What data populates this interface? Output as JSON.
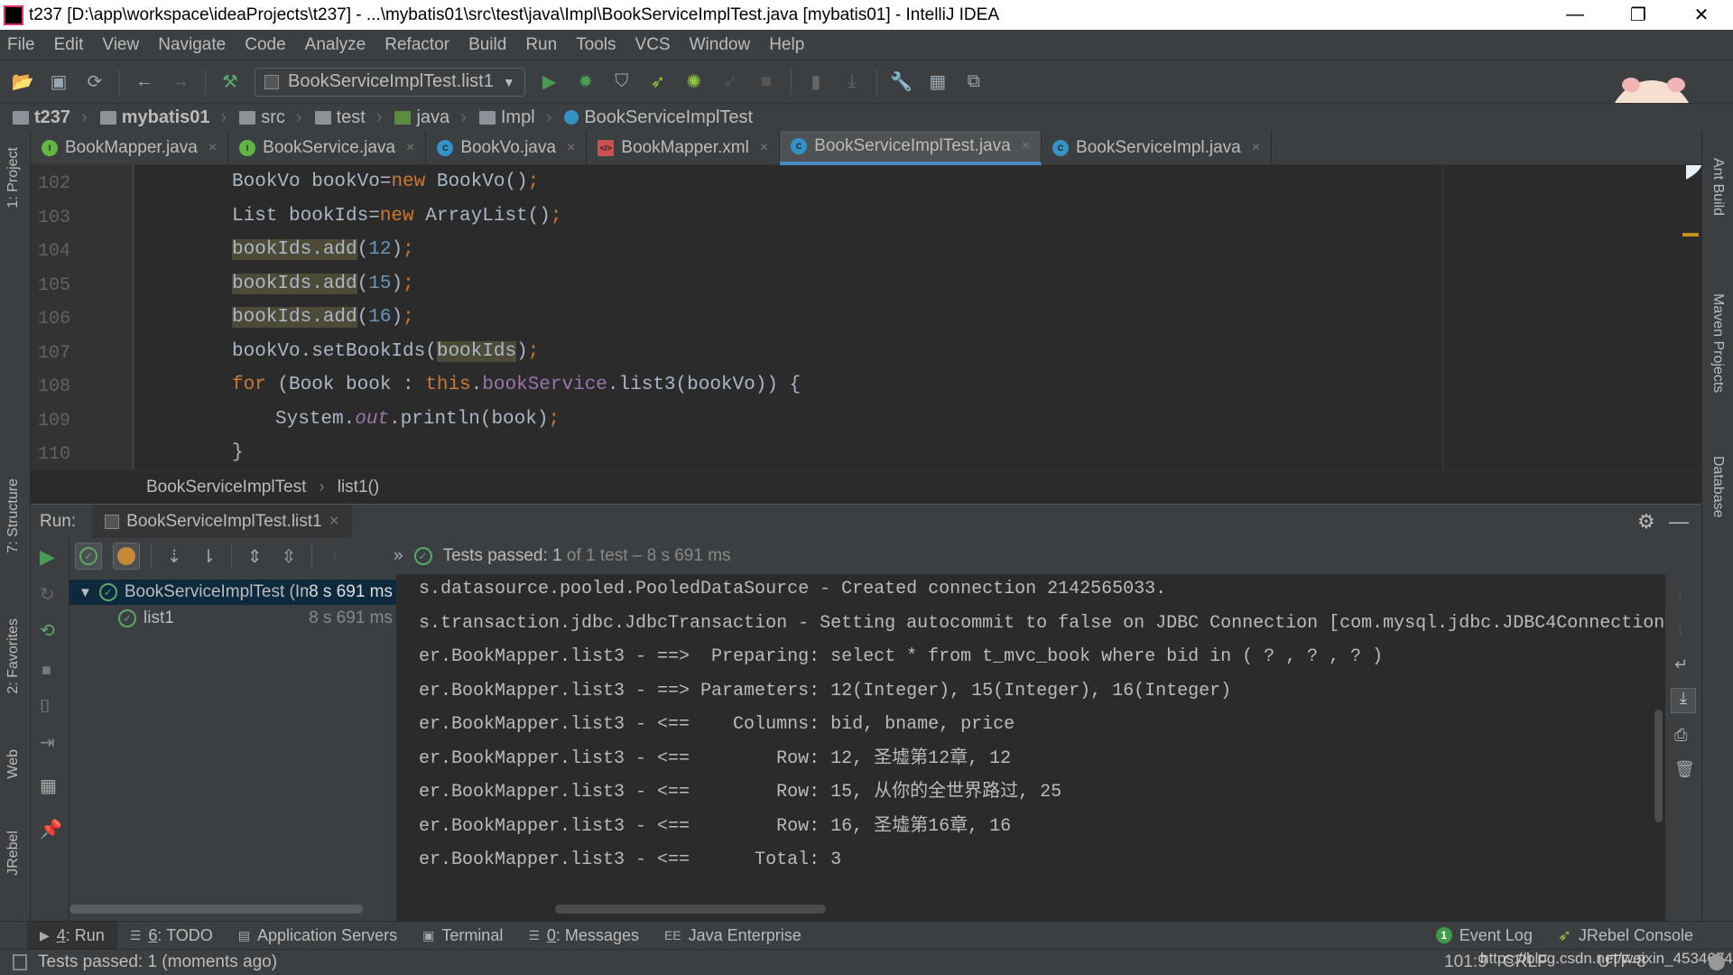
{
  "window": {
    "title": "t237 [D:\\app\\workspace\\ideaProjects\\t237] - ...\\mybatis01\\src\\test\\java\\Impl\\BookServiceImplTest.java [mybatis01] - IntelliJ IDEA",
    "minimize": "—",
    "maximize": "❐",
    "close": "✕"
  },
  "menu": [
    "File",
    "Edit",
    "View",
    "Navigate",
    "Code",
    "Analyze",
    "Refactor",
    "Build",
    "Run",
    "Tools",
    "VCS",
    "Window",
    "Help"
  ],
  "toolbar": {
    "run_config": "BookServiceImplTest.list1"
  },
  "breadcrumb": [
    "t237",
    "mybatis01",
    "src",
    "test",
    "java",
    "Impl",
    "BookServiceImplTest"
  ],
  "tabs": [
    {
      "label": "BookMapper.java",
      "icon": "I",
      "color": "#62b543",
      "active": false
    },
    {
      "label": "BookService.java",
      "icon": "I",
      "color": "#62b543",
      "active": false
    },
    {
      "label": "BookVo.java",
      "icon": "C",
      "color": "#3592c4",
      "active": false
    },
    {
      "label": "BookMapper.xml",
      "icon": "</>",
      "color": "#c75450",
      "active": false
    },
    {
      "label": "BookServiceImplTest.java",
      "icon": "C",
      "color": "#3592c4",
      "active": true
    },
    {
      "label": "BookServiceImpl.java",
      "icon": "C",
      "color": "#3592c4",
      "active": false
    }
  ],
  "editor": {
    "lines": [
      {
        "no": "102",
        "indent": 0,
        "tokens": [
          {
            "t": "BookVo bookVo=",
            "c": "p"
          },
          {
            "t": "new",
            "c": "k"
          },
          {
            "t": " BookVo()",
            "c": "p"
          },
          {
            "t": ";",
            "c": "s"
          }
        ]
      },
      {
        "no": "103",
        "indent": 0,
        "tokens": [
          {
            "t": "List bookIds=",
            "c": "p"
          },
          {
            "t": "new",
            "c": "k"
          },
          {
            "t": " ArrayList()",
            "c": "p"
          },
          {
            "t": ";",
            "c": "s"
          }
        ]
      },
      {
        "no": "104",
        "indent": 0,
        "tokens": [
          {
            "t": "bookIds.add",
            "c": "p hl"
          },
          {
            "t": "(",
            "c": "p"
          },
          {
            "t": "12",
            "c": "n"
          },
          {
            "t": ")",
            "c": "p"
          },
          {
            "t": ";",
            "c": "s"
          }
        ]
      },
      {
        "no": "105",
        "indent": 0,
        "tokens": [
          {
            "t": "bookIds.add",
            "c": "p hl"
          },
          {
            "t": "(",
            "c": "p"
          },
          {
            "t": "15",
            "c": "n"
          },
          {
            "t": ")",
            "c": "p"
          },
          {
            "t": ";",
            "c": "s"
          }
        ]
      },
      {
        "no": "106",
        "indent": 0,
        "tokens": [
          {
            "t": "bookIds.add",
            "c": "p hl"
          },
          {
            "t": "(",
            "c": "p"
          },
          {
            "t": "16",
            "c": "n"
          },
          {
            "t": ")",
            "c": "p"
          },
          {
            "t": ";",
            "c": "s"
          }
        ]
      },
      {
        "no": "107",
        "indent": 0,
        "tokens": [
          {
            "t": "bookVo.setBookIds(",
            "c": "p"
          },
          {
            "t": "bookIds",
            "c": "p hl"
          },
          {
            "t": ")",
            "c": "p"
          },
          {
            "t": ";",
            "c": "s"
          }
        ]
      },
      {
        "no": "108",
        "indent": 0,
        "tokens": [
          {
            "t": "for",
            "c": "k"
          },
          {
            "t": " (Book book : ",
            "c": "p"
          },
          {
            "t": "this",
            "c": "k"
          },
          {
            "t": ".",
            "c": "p"
          },
          {
            "t": "bookService",
            "c": "f"
          },
          {
            "t": ".list3(bookVo)) {",
            "c": "p"
          }
        ]
      },
      {
        "no": "109",
        "indent": 1,
        "tokens": [
          {
            "t": "System.",
            "c": "p"
          },
          {
            "t": "out",
            "c": "i"
          },
          {
            "t": ".println(book)",
            "c": "p"
          },
          {
            "t": ";",
            "c": "s"
          }
        ]
      },
      {
        "no": "110",
        "indent": 0,
        "tokens": [
          {
            "t": "}",
            "c": "p"
          }
        ]
      }
    ],
    "crumbs": [
      "BookServiceImplTest",
      "list1()"
    ]
  },
  "run": {
    "label": "Run:",
    "tab": "BookServiceImplTest.list1",
    "status_prefix": "Tests passed: ",
    "status_count": "1",
    "status_suffix": " of 1 test – 8 s 691 ms",
    "tree": [
      {
        "label": "BookServiceImplTest (Im",
        "time": "8 s 691 ms",
        "level": 0
      },
      {
        "label": "list1",
        "time": "8 s 691 ms",
        "level": 1
      }
    ],
    "console": [
      "s.datasource.pooled.PooledDataSource - Created connection 2142565033.",
      "s.transaction.jdbc.JdbcTransaction - Setting autocommit to false on JDBC Connection [com.mysql.jdbc.JDBC4Connection",
      "er.BookMapper.list3 - ==>  Preparing: select * from t_mvc_book where bid in ( ? , ? , ? )",
      "er.BookMapper.list3 - ==> Parameters: 12(Integer), 15(Integer), 16(Integer)",
      "er.BookMapper.list3 - <==    Columns: bid, bname, price",
      "er.BookMapper.list3 - <==        Row: 12, 圣墟第12章, 12",
      "er.BookMapper.list3 - <==        Row: 15, 从你的全世界路过, 25",
      "er.BookMapper.list3 - <==        Row: 16, 圣墟第16章, 16",
      "er.BookMapper.list3 - <==      Total: 3"
    ]
  },
  "left_strip": [
    "1: Project",
    "7: Structure",
    "2: Favorites",
    "Web",
    "JRebel"
  ],
  "right_strip": [
    "Ant Build",
    "Maven Projects",
    "Database"
  ],
  "bottom_tools": [
    {
      "num": "4",
      "label": ": Run",
      "icon": "▶",
      "active": true
    },
    {
      "num": "6",
      "label": ": TODO",
      "icon": "☰",
      "active": false
    },
    {
      "num": "",
      "label": "Application Servers",
      "icon": "▤",
      "active": false
    },
    {
      "num": "",
      "label": "Terminal",
      "icon": "▣",
      "active": false
    },
    {
      "num": "0",
      "label": ": Messages",
      "icon": "☰",
      "active": false
    },
    {
      "num": "",
      "label": "Java Enterprise",
      "icon": "EE",
      "active": false
    }
  ],
  "bottom_right": {
    "event_log": "Event Log",
    "event_count": "1",
    "jrebel": "JRebel Console"
  },
  "status": {
    "message": "Tests passed: 1 (moments ago)",
    "position": "101:9",
    "line_sep": "CRLF",
    "encoding": "UTF-8",
    "watermark": "https://blog.csdn.net/weixin_45346741"
  }
}
